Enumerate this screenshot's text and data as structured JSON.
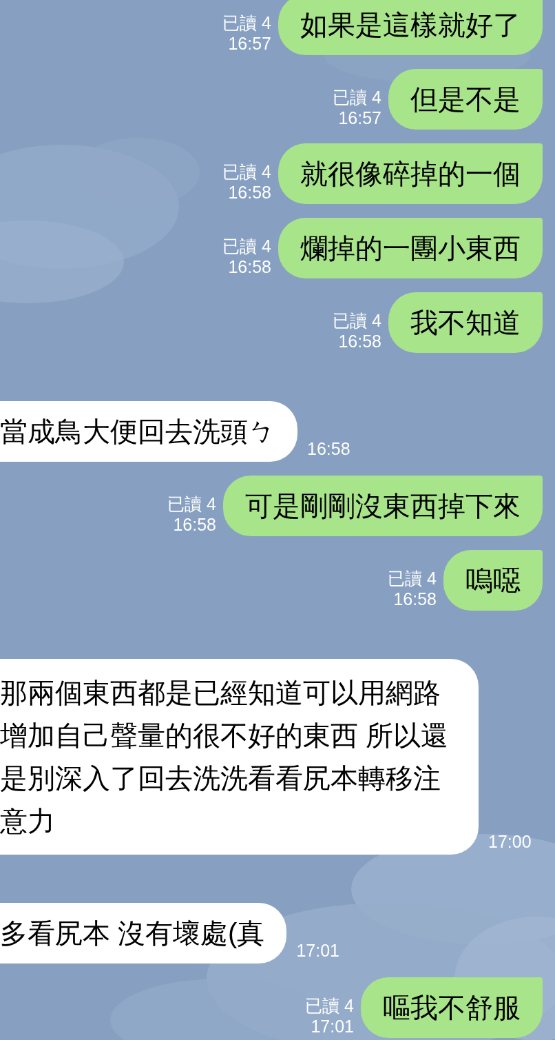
{
  "messages": [
    {
      "kind": "sent",
      "text": "如果是這樣就好了",
      "read": "已讀 4",
      "time": "16:57"
    },
    {
      "kind": "sent",
      "text": "但是不是",
      "read": "已讀 4",
      "time": "16:57"
    },
    {
      "kind": "sent",
      "text": "就很像碎掉的一個",
      "read": "已讀 4",
      "time": "16:58"
    },
    {
      "kind": "sent",
      "text": "爛掉的一團小東西",
      "read": "已讀 4",
      "time": "16:58"
    },
    {
      "kind": "sent",
      "text": "我不知道",
      "read": "已讀 4",
      "time": "16:58"
    },
    {
      "kind": "received",
      "text": "當成鳥大便回去洗頭ㄅ",
      "time": "16:58"
    },
    {
      "kind": "sent",
      "text": "可是剛剛沒東西掉下來",
      "read": "已讀 4",
      "time": "16:58"
    },
    {
      "kind": "sent",
      "text": "嗚噁",
      "read": "已讀 4",
      "time": "16:58"
    },
    {
      "kind": "received",
      "text": "那兩個東西都是已經知道可以用網路增加自己聲量的很不好的東西 所以還是別深入了回去洗洗看看尻本轉移注意力",
      "time": "17:00"
    },
    {
      "kind": "received",
      "text": "多看尻本 沒有壞處(真",
      "time": "17:01"
    },
    {
      "kind": "sent",
      "text": "嘔我不舒服",
      "read": "已讀 4",
      "time": "17:01"
    }
  ]
}
